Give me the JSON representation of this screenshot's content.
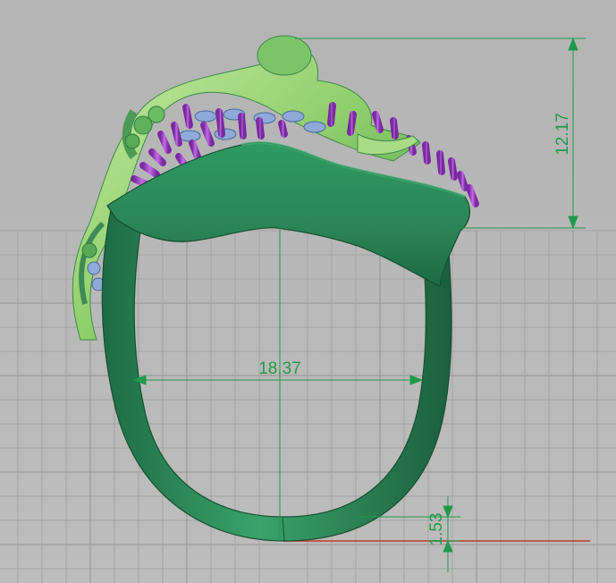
{
  "viewport": {
    "background": "#b9b9b9",
    "grid_color": "#9e9e9e",
    "axis_color": "#c0392b"
  },
  "dimensions": {
    "height_label": "12.17",
    "inner_diameter_label": "18.37",
    "band_thickness_label": "1.53",
    "color": "#1f9a4a"
  },
  "model": {
    "shank_color": "#2e8b57",
    "figure_color": "#8fd06a",
    "prong_color": "#9b3fc0",
    "stone_color": "#8fa9d8"
  }
}
